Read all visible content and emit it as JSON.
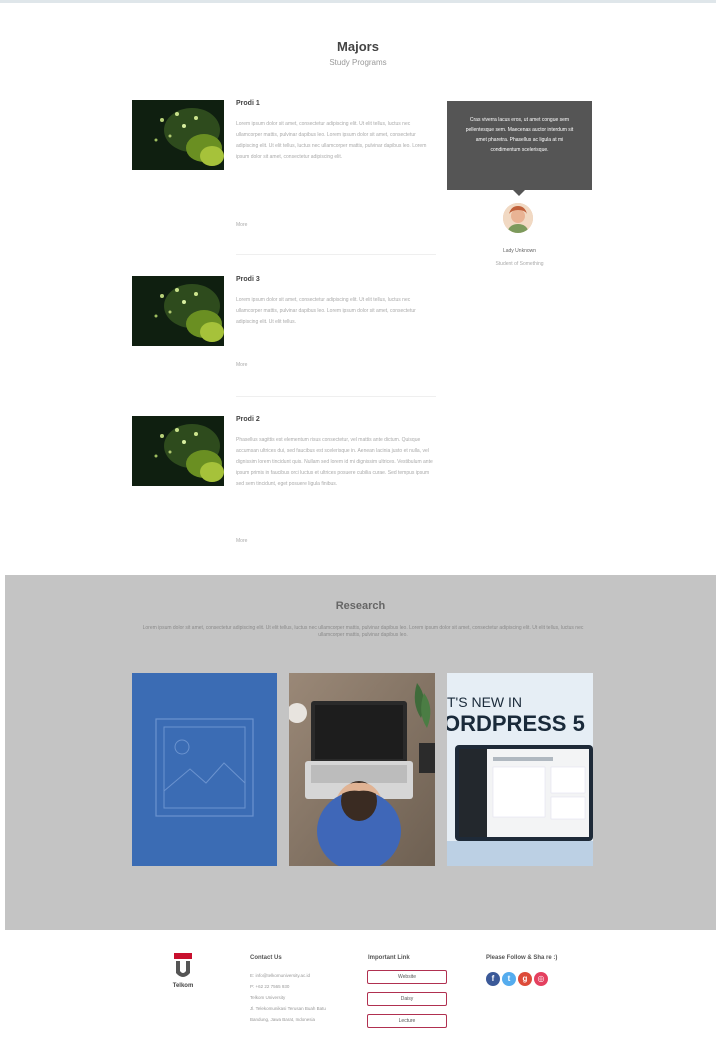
{
  "majors": {
    "title": "Majors",
    "subtitle": "Study Programs"
  },
  "posts": [
    {
      "title": "Prodi 1",
      "text": "Lorem ipsum dolor sit amet, consectetur adipiscing elit. Ut elit tellus, luctus nec ullamcorper mattis, pulvinar dapibus leo. Lorem ipsum dolor sit amet, consectetur adipiscing elit. Ut elit tellus, luctus nec ullamcorper mattis, pulvinar dapibus leo. Lorem ipsum dolor sit amet, consectetur adipiscing elit.",
      "more": "More"
    },
    {
      "title": "Prodi 3",
      "text": "Lorem ipsum dolor sit amet, consectetur adipiscing elit. Ut elit tellus, luctus nec ullamcorper mattis, pulvinar dapibus leo. Lorem ipsum dolor sit amet, consectetur adipiscing elit. Ut elit tellus.",
      "more": "More"
    },
    {
      "title": "Prodi 2",
      "text": "Phasellus sagittis est elementum risus consectetur, vel mattis ante dictum. Quisque accumsan ultrices dui, sed faucibus est scelerisque in. Aenean lacinia justo et nulla, vel dignissim lorem tincidunt quis. Nullam sed lorem id mi dignissim ultrices. Vestibulum ante ipsum primis in faucibus orci luctus et ultrices posuere cubilia curae. Sed tempus ipsum sed sem tincidunt, eget posuere ligula finibus.",
      "more": "More"
    }
  ],
  "testimonial": {
    "quote": "Cras viverra lacus eros, ut amet congue sem pellentesque sem. Maecenas auctor interdum sit amet pharetra. Phasellus ac ligula at mi condimentum scelerisque.",
    "name": "Lady Unknown",
    "role": "Student of Something"
  },
  "research": {
    "title": "Research",
    "description": "Lorem ipsum dolor sit amet, consectetur adipiscing elit. Ut elit tellus, luctus nec ullamcorper mattis, pulvinar dapibus leo. Lorem ipsum dolor sit amet, consectetur adipiscing elit. Ut elit tellus, luctus nec ullamcorper mattis, pulvinar dapibus leo.",
    "card3_line1": "T'S NEW IN",
    "card3_line2": "ORDPRESS 5"
  },
  "footer": {
    "logo_text": "Telkom",
    "contact_title": "Contact Us",
    "contact_lines": [
      "E: info@telkomuniversity.ac.id",
      "P: +62 22 7565 930",
      "Telkom University",
      "Jl. Telekomunikasi Terusan Buah Batu",
      "Bandung, Jawa Barat, Indonesia"
    ],
    "links_title": "Important Link",
    "links": [
      "Website",
      "Daisy",
      "Lecture"
    ],
    "social_title": "Please Follow & Sha re :)",
    "social_icons": [
      "facebook-icon",
      "twitter-icon",
      "google-plus-icon",
      "instagram-icon"
    ],
    "social_colors": [
      "#3b5998",
      "#55acee",
      "#dd4b39",
      "#e4405f"
    ]
  }
}
